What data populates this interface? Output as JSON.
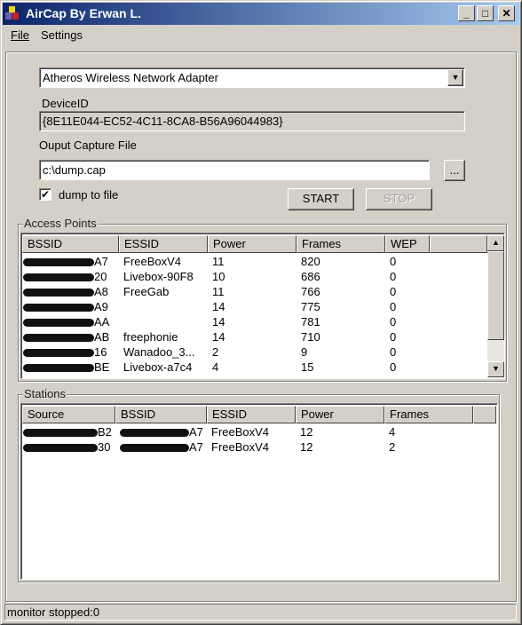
{
  "window": {
    "title": "AirCap By Erwan L.",
    "controls": [
      "_",
      "□",
      "✕"
    ]
  },
  "menu": [
    "File",
    "Settings"
  ],
  "adapter": {
    "selected": "Atheros Wireless Network Adapter"
  },
  "device": {
    "label": "DeviceID",
    "value": "{8E11E044-EC52-4C11-8CA8-B56A96044983}"
  },
  "output": {
    "label": "Ouput Capture File",
    "value": "c:\\dump.cap",
    "browse_label": "..."
  },
  "dump": {
    "label": "dump to file",
    "checked": true
  },
  "buttons": {
    "start": "START",
    "stop": "STOP"
  },
  "access_points": {
    "title": "Access Points",
    "columns": [
      "BSSID",
      "ESSID",
      "Power",
      "Frames",
      "WEP"
    ],
    "rows": [
      {
        "bssid": "A7",
        "essid": "FreeBoxV4",
        "power": "11",
        "frames": "820",
        "wep": "0"
      },
      {
        "bssid": "20",
        "essid": "Livebox-90F8",
        "power": "10",
        "frames": "686",
        "wep": "0"
      },
      {
        "bssid": "A8",
        "essid": "FreeGab",
        "power": "11",
        "frames": "766",
        "wep": "0"
      },
      {
        "bssid": "A9",
        "essid": "",
        "power": "14",
        "frames": "775",
        "wep": "0"
      },
      {
        "bssid": "AA",
        "essid": "",
        "power": "14",
        "frames": "781",
        "wep": "0"
      },
      {
        "bssid": "AB",
        "essid": "freephonie",
        "power": "14",
        "frames": "710",
        "wep": "0"
      },
      {
        "bssid": "16",
        "essid": "Wanadoo_3...",
        "power": "2",
        "frames": "9",
        "wep": "0"
      },
      {
        "bssid": "BE",
        "essid": "Livebox-a7c4",
        "power": "4",
        "frames": "15",
        "wep": "0"
      }
    ]
  },
  "stations": {
    "title": "Stations",
    "columns": [
      "Source",
      "BSSID",
      "ESSID",
      "Power",
      "Frames"
    ],
    "rows": [
      {
        "source": "B2",
        "bssid": "A7",
        "essid": "FreeBoxV4",
        "power": "12",
        "frames": "4"
      },
      {
        "source": "30",
        "bssid": "A7",
        "essid": "FreeBoxV4",
        "power": "12",
        "frames": "2"
      }
    ]
  },
  "status": "monitor stopped:0"
}
